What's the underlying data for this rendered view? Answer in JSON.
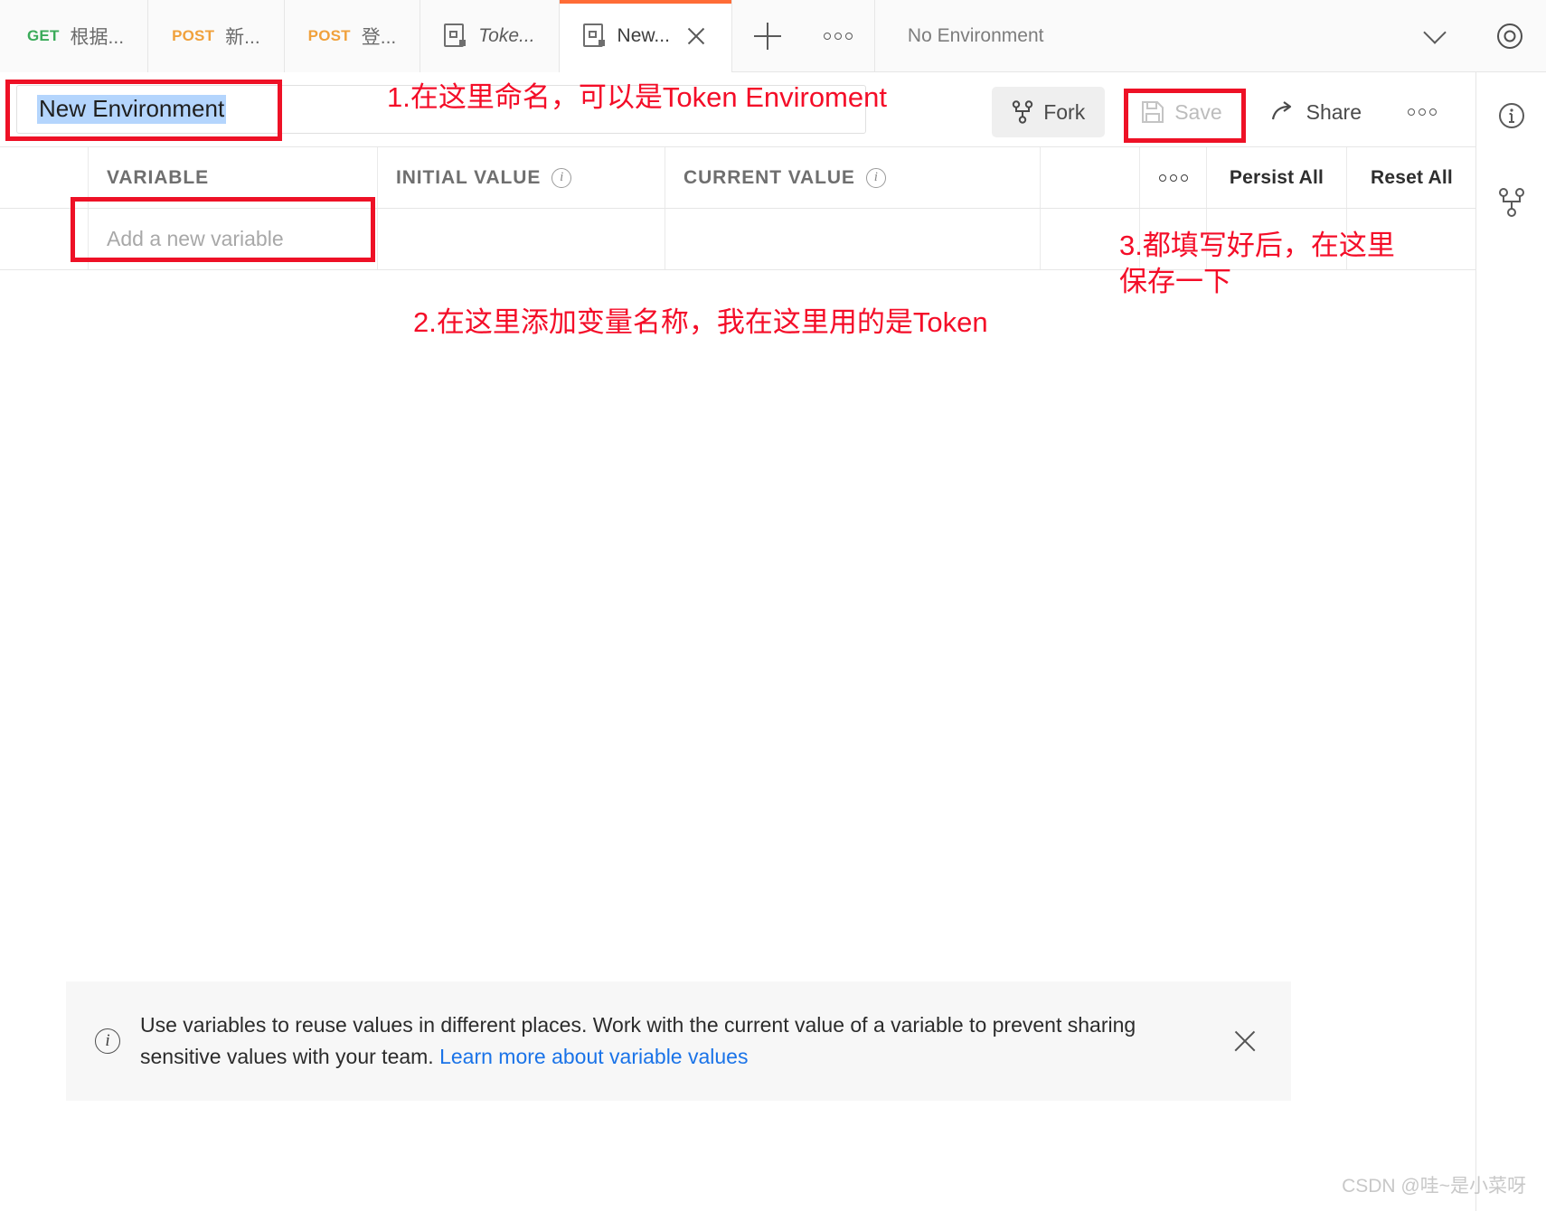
{
  "tabbar": {
    "tabs": [
      {
        "method": "GET",
        "method_kind": "get",
        "name": "根据...",
        "icon": "",
        "active": false
      },
      {
        "method": "POST",
        "method_kind": "post",
        "name": "新...",
        "icon": "",
        "active": false
      },
      {
        "method": "POST",
        "method_kind": "post",
        "name": "登...",
        "icon": "",
        "active": false
      },
      {
        "method": "",
        "method_kind": "",
        "name": "Toke...",
        "icon": "environment-icon",
        "active": false
      },
      {
        "method": "",
        "method_kind": "",
        "name": "New...",
        "icon": "environment-icon",
        "active": true
      }
    ],
    "add_tab_icon": "plus-icon",
    "more_tabs_icon": "ellipsis-icon",
    "environment_selector": "No Environment",
    "environment_chevron_icon": "chevron-down-icon",
    "eye_icon": "eye-icon"
  },
  "editor": {
    "name_value": "New Environment",
    "toolbar": {
      "fork_label": "Fork",
      "fork_icon": "fork-icon",
      "save_label": "Save",
      "save_icon": "floppy-disk-icon",
      "share_label": "Share",
      "share_icon": "share-arrow-icon",
      "more_icon": "ellipsis-icon"
    },
    "table": {
      "headers": {
        "variable": "VARIABLE",
        "initial_value": "INITIAL VALUE",
        "current_value": "CURRENT VALUE",
        "initial_info_icon": "info-icon",
        "current_info_icon": "info-icon",
        "more_icon": "ellipsis-icon",
        "persist_all": "Persist All",
        "reset_all": "Reset All"
      },
      "new_row_placeholder": "Add a new variable"
    }
  },
  "annotations": [
    {
      "id": "a1",
      "text": "1.在这里命名，可以是Token Enviroment"
    },
    {
      "id": "a2",
      "text": "2.在这里添加变量名称，我在这里用的是Token"
    },
    {
      "id": "a3",
      "text": "3.都填写好后，在这里\n保存一下"
    }
  ],
  "banner": {
    "info_icon": "info-icon",
    "text_before_link": "Use variables to reuse values in different places. Work with the current value of a variable to prevent sharing sensitive values with your team. ",
    "link_text": "Learn more about variable values",
    "close_icon": "close-icon"
  },
  "rail": {
    "info_icon": "info-icon",
    "fork_icon": "fork-icon"
  },
  "watermark": "CSDN @哇~是小菜呀",
  "colors": {
    "accent_orange": "#ff6c37",
    "annotation_red": "#f40d28",
    "link_blue": "#1a73e8",
    "get_green": "#3bab5a",
    "post_orange": "#f0a13c",
    "selection_blue": "#b4d5fd"
  }
}
